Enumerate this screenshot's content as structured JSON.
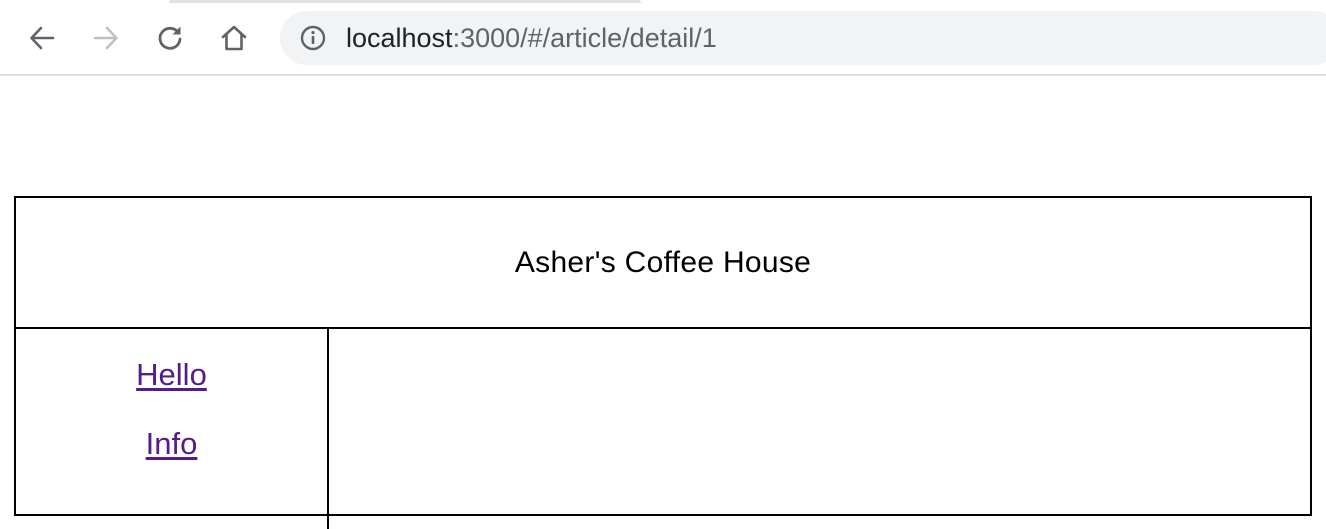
{
  "browser": {
    "url_host": "localhost",
    "url_rest": ":3000/#/article/detail/1",
    "icons": {
      "back": "arrow-left-icon",
      "forward": "arrow-right-icon",
      "reload": "reload-icon",
      "home": "home-icon",
      "site_info": "info-icon"
    },
    "colors": {
      "icon_active": "#5f6368",
      "icon_disabled": "#bdc1c6",
      "omnibox_bg": "#f1f3f4"
    }
  },
  "page": {
    "header_title": "Asher's Coffee House",
    "nav": [
      {
        "label": "Hello"
      },
      {
        "label": "Info"
      }
    ],
    "colors": {
      "visited_link": "#551a8b",
      "border": "#000000"
    }
  }
}
